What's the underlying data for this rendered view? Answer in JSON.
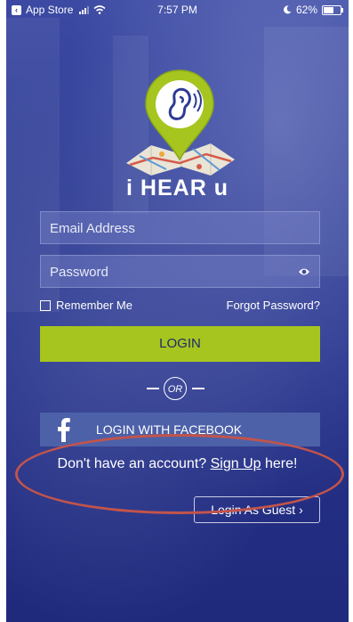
{
  "status_bar": {
    "back_app": "App Store",
    "time": "7:57 PM",
    "battery": "62%",
    "battery_level": 0.62
  },
  "app": {
    "title": "i HEAR u"
  },
  "form": {
    "email_placeholder": "Email Address",
    "password_placeholder": "Password",
    "remember_label": "Remember Me",
    "forgot_label": "Forgot Password?",
    "login_label": "LOGIN",
    "or_label": "OR",
    "facebook_label": "LOGIN WITH FACEBOOK",
    "signup_prefix": "Don't have an account? ",
    "signup_link": "Sign Up",
    "signup_suffix": " here!",
    "guest_label": "Login As Guest ›"
  },
  "colors": {
    "background": "#2c3a93",
    "accent_green": "#a6c51f",
    "facebook_blue": "#4d61a9",
    "annotation_red": "#c2544b"
  },
  "icons": [
    "back-badge-icon",
    "signal-icon",
    "wifi-icon",
    "moon-icon",
    "battery-icon",
    "ear-pin-logo-icon",
    "eye-icon",
    "checkbox-icon",
    "facebook-icon"
  ]
}
